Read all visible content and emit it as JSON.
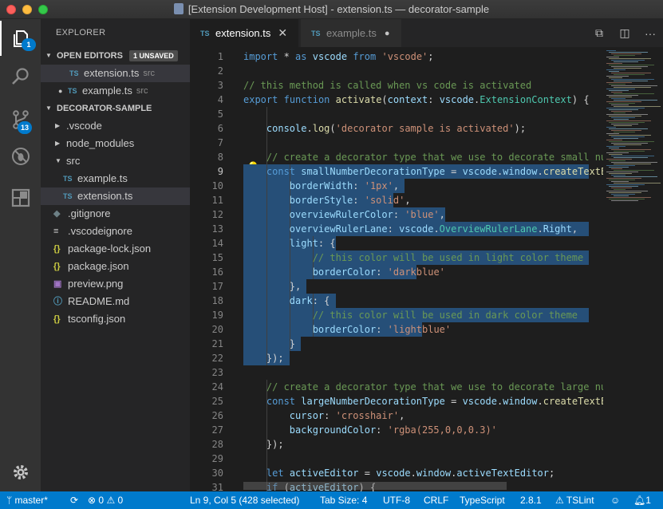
{
  "window": {
    "title": "[Extension Development Host] - extension.ts — decorator-sample"
  },
  "activity_bar": {
    "explorer_badge": "1",
    "scm_badge": "13"
  },
  "sidebar": {
    "title": "EXPLORER",
    "open_editors": {
      "label": "OPEN EDITORS",
      "badge": "1 UNSAVED",
      "items": [
        {
          "tag": "TS",
          "name": "extension.ts",
          "dir": "src"
        },
        {
          "tag": "TS",
          "name": "example.ts",
          "dir": "src"
        }
      ]
    },
    "folder": {
      "label": "DECORATOR-SAMPLE",
      "items": [
        {
          "name": ".vscode"
        },
        {
          "name": "node_modules"
        },
        {
          "name": "src"
        },
        {
          "tag": "TS",
          "name": "example.ts"
        },
        {
          "tag": "TS",
          "name": "extension.ts"
        },
        {
          "name": ".gitignore"
        },
        {
          "name": ".vscodeignore"
        },
        {
          "name": "package-lock.json"
        },
        {
          "name": "package.json"
        },
        {
          "name": "preview.png"
        },
        {
          "name": "README.md"
        },
        {
          "name": "tsconfig.json"
        }
      ]
    }
  },
  "tabs": [
    {
      "tag": "TS",
      "label": "extension.ts",
      "active": true
    },
    {
      "tag": "TS",
      "label": "example.ts",
      "active": false,
      "dirty": true
    }
  ],
  "editor": {
    "line_numbers": [
      "1",
      "2",
      "3",
      "4",
      "5",
      "6",
      "7",
      "8",
      "9",
      "10",
      "11",
      "12",
      "13",
      "14",
      "15",
      "16",
      "17",
      "18",
      "19",
      "20",
      "21",
      "22",
      "23",
      "24",
      "25",
      "26",
      "27",
      "28",
      "29",
      "30",
      "31"
    ]
  },
  "status_bar": {
    "branch": "master*",
    "errors": "0",
    "warnings": "0",
    "position": "Ln 9, Col 5 (428 selected)",
    "tab_size": "Tab Size: 4",
    "encoding": "UTF-8",
    "eol": "CRLF",
    "language": "TypeScript",
    "ts_version": "2.8.1",
    "linter": "TSLint",
    "notifications": "1"
  }
}
